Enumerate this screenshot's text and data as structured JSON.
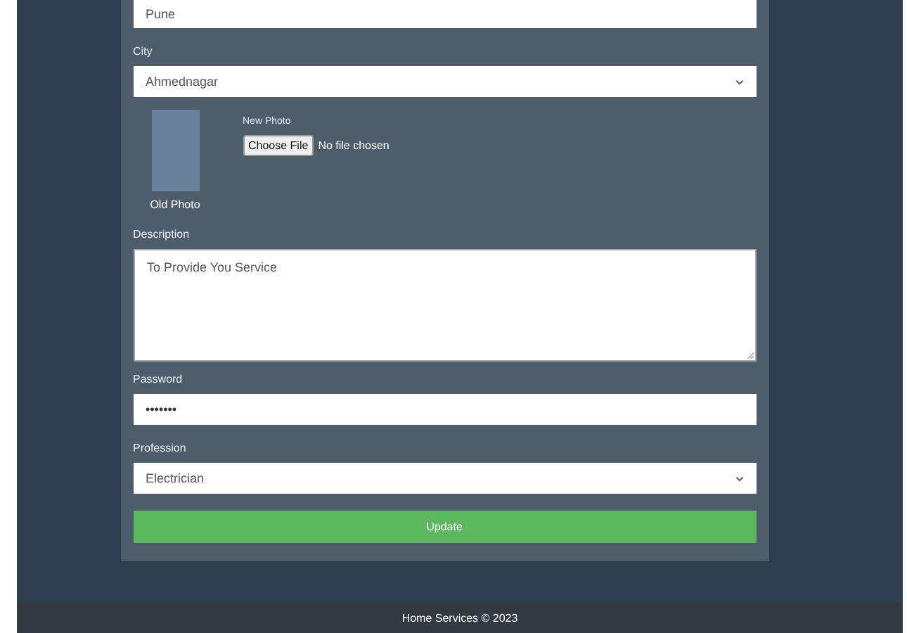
{
  "fields_top": {
    "value": "Pune"
  },
  "city": {
    "label": "City",
    "value": "Ahmednagar"
  },
  "photo": {
    "old_caption": "Old Photo",
    "new_label": "New Photo",
    "button": "Choose File",
    "status": "No file chosen"
  },
  "description": {
    "label": "Description",
    "value": "To Provide You Service"
  },
  "password": {
    "label": "Password",
    "value": "•••••••"
  },
  "profession": {
    "label": "Profession",
    "value": "Electrician"
  },
  "submit": "Update",
  "footer": "Home Services © 2023"
}
